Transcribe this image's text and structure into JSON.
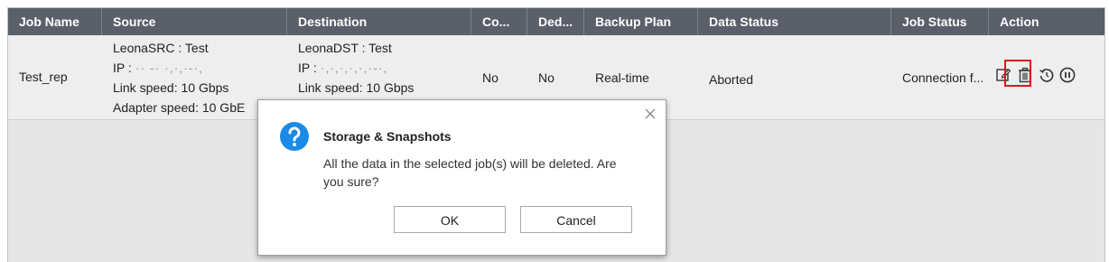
{
  "table": {
    "headers": [
      "Job Name",
      "Source",
      "Destination",
      "Co...",
      "Ded...",
      "Backup Plan",
      "Data Status",
      "Job Status",
      "Action"
    ],
    "row": {
      "job_name": "Test_rep",
      "source": {
        "name": "LeonaSRC : Test",
        "ip_label": "IP :",
        "ip_value": "·· -·  ·,·,·-·,",
        "link_speed": "Link speed: 10 Gbps",
        "adapter_speed": "Adapter speed: 10 GbE"
      },
      "destination": {
        "name": "LeonaDST : Test",
        "ip_label": "IP :",
        "ip_value": "·,·,·,·,·,·-·,",
        "link_speed": "Link speed: 10 Gbps"
      },
      "compression": "No",
      "dedup": "No",
      "backup_plan": "Real-time",
      "data_status": "Aborted",
      "job_status": "Connection f...",
      "actions": [
        "edit-icon",
        "trash-icon",
        "restore-icon",
        "pause-icon"
      ]
    }
  },
  "dialog": {
    "title": "Storage & Snapshots",
    "message": "All the data in the selected job(s) will be deleted. Are you sure?",
    "ok_label": "OK",
    "cancel_label": "Cancel",
    "icon": "question-icon"
  },
  "colors": {
    "header_bg": "#5a5f6a",
    "highlight": "#e0141c",
    "question_blue": "#1a8ae6"
  }
}
